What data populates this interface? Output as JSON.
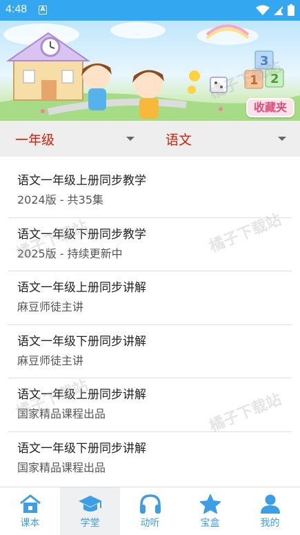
{
  "status_bar": {
    "time": "4:48",
    "notification_badge": "A"
  },
  "banner": {
    "favorite_label": "收藏夹",
    "watermark": "橘子下载站"
  },
  "selectors": {
    "grade": "一年级",
    "subject": "语文"
  },
  "courses": [
    {
      "title": "语文一年级上册同步教学",
      "subtitle": "2024版 - 共35集"
    },
    {
      "title": "语文一年级下册同步教学",
      "subtitle": "2025版 - 持续更新中"
    },
    {
      "title": "语文一年级上册同步讲解",
      "subtitle": "麻豆师徒主讲"
    },
    {
      "title": "语文一年级下册同步讲解",
      "subtitle": "麻豆师徒主讲"
    },
    {
      "title": "语文一年级上册同步讲解",
      "subtitle": "国家精品课程出品"
    },
    {
      "title": "语文一年级下册同步讲解",
      "subtitle": "国家精品课程出品"
    }
  ],
  "watermark": "橘子下载站",
  "bottom_nav": {
    "items": [
      {
        "label": "课本",
        "icon": "house-icon"
      },
      {
        "label": "学堂",
        "icon": "graduation-cap-icon"
      },
      {
        "label": "动听",
        "icon": "headphones-icon"
      },
      {
        "label": "宝盒",
        "icon": "star-icon"
      },
      {
        "label": "我的",
        "icon": "person-icon"
      }
    ],
    "active_index": 1
  },
  "colors": {
    "status_bar": "#33a7ef",
    "selector_text": "#d81e06",
    "nav_icon": "#3d9ee6"
  }
}
